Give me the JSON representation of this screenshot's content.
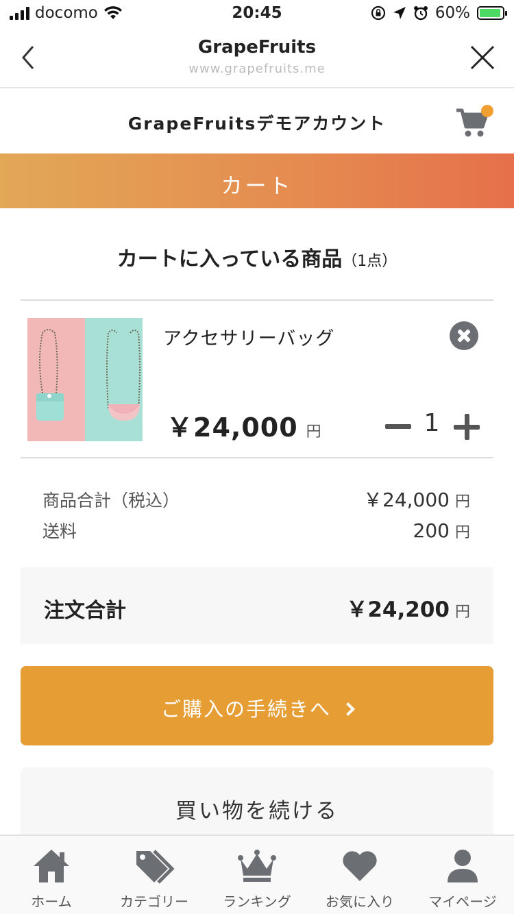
{
  "status_bar": {
    "carrier": "docomo",
    "time": "20:45",
    "battery": "60%"
  },
  "nav": {
    "title": "GrapeFruits",
    "url": "www.grapefruits.me"
  },
  "shop": {
    "name": "GrapeFruitsデモアカウント"
  },
  "banner": {
    "title": "カート"
  },
  "cart": {
    "heading": "カートに入っている商品",
    "count_label": "（1点）",
    "item": {
      "name": "アクセサリーバッグ",
      "price": "￥24,000",
      "unit": "円",
      "quantity": "1"
    }
  },
  "summary": {
    "subtotal_label": "商品合計（税込）",
    "subtotal_value": "￥24,000",
    "shipping_label": "送料",
    "shipping_value": "200",
    "unit": "円",
    "total_label": "注文合計",
    "total_value": "￥24,200"
  },
  "actions": {
    "checkout": "ご購入の手続きへ",
    "continue": "買い物を続ける"
  },
  "tabs": [
    {
      "label": "ホーム",
      "icon": "home-icon"
    },
    {
      "label": "カテゴリー",
      "icon": "tags-icon"
    },
    {
      "label": "ランキング",
      "icon": "crown-icon"
    },
    {
      "label": "お気に入り",
      "icon": "heart-icon"
    },
    {
      "label": "マイページ",
      "icon": "user-icon"
    }
  ],
  "colors": {
    "accent": "#e69d33",
    "banner_start": "#e2a856",
    "banner_end": "#e5704a",
    "icon": "#6b6e72"
  }
}
